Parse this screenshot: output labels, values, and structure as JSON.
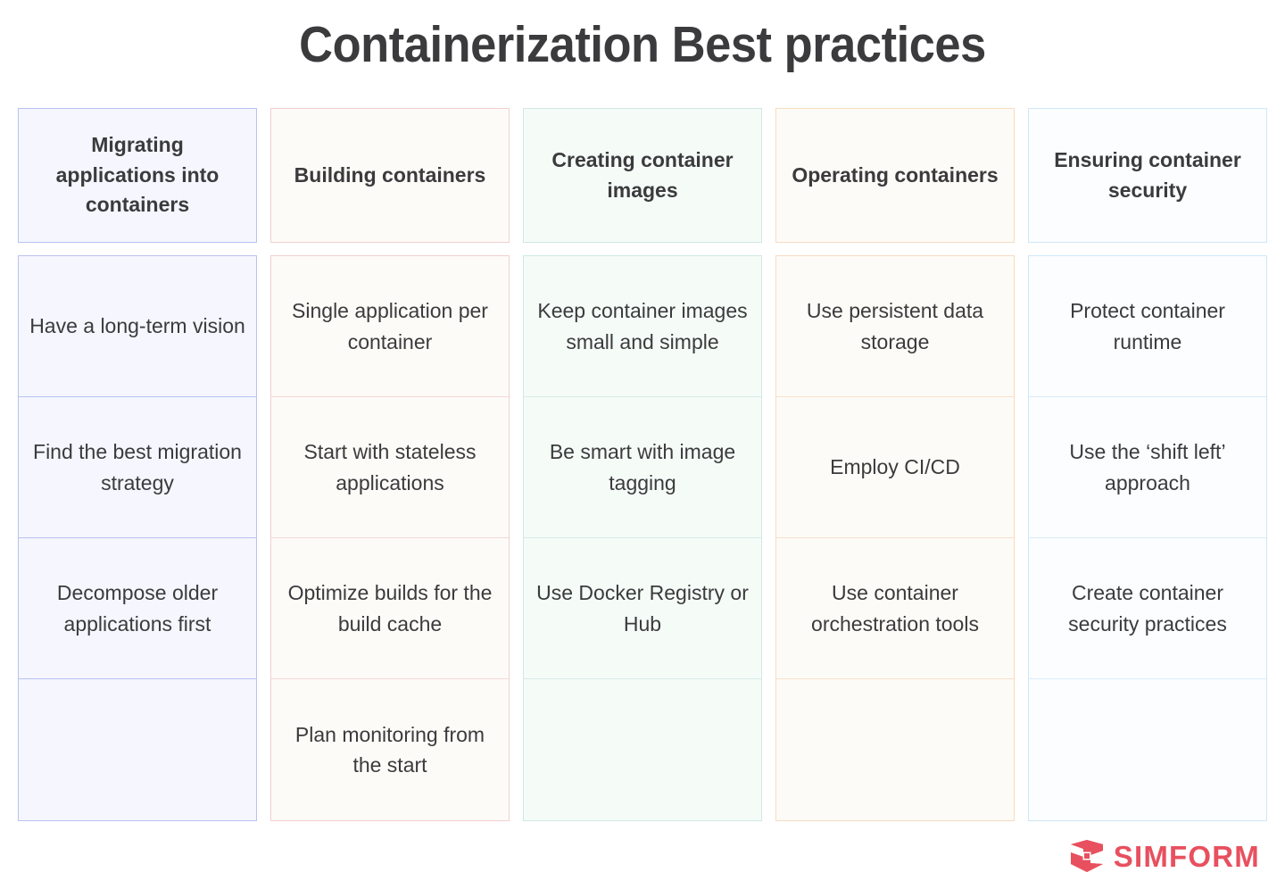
{
  "page": {
    "title": "Containerization Best practices",
    "background_color": "#ffffff",
    "text_color": "#3b3b3d"
  },
  "columns": [
    {
      "header": "Migrating applications into containers",
      "accent_border": "#b9c2f0",
      "accent_fill": "#f5f6fe",
      "items": [
        "Have a long-term vision",
        "Find the best migration strategy",
        "Decompose older applications first",
        ""
      ]
    },
    {
      "header": "Building containers",
      "accent_border": "#f4cfcf",
      "accent_fill": "#fdfbf8",
      "items": [
        "Single application per container",
        "Start with stateless applications",
        "Optimize builds for the build cache",
        "Plan monitoring from the start"
      ]
    },
    {
      "header": "Creating container images",
      "accent_border": "#cfe8e4",
      "accent_fill": "#f5fcf8",
      "items": [
        "Keep container images small and simple",
        "Be smart with image tagging",
        "Use Docker Registry or Hub",
        ""
      ]
    },
    {
      "header": "Operating containers",
      "accent_border": "#f8dcc0",
      "accent_fill": "#fdfbf7",
      "items": [
        "Use persistent data storage",
        "Employ CI/CD",
        "Use container orchestration tools",
        ""
      ]
    },
    {
      "header": "Ensuring container security",
      "accent_border": "#cfe7f8",
      "accent_fill": "#fbfdfe",
      "items": [
        "Protect container runtime",
        "Use the ‘shift left’ approach",
        "Create container security practices",
        ""
      ]
    }
  ],
  "logo": {
    "text": "SIMFORM",
    "mark": "simform-diamond-icon",
    "color": "#e8505f"
  }
}
